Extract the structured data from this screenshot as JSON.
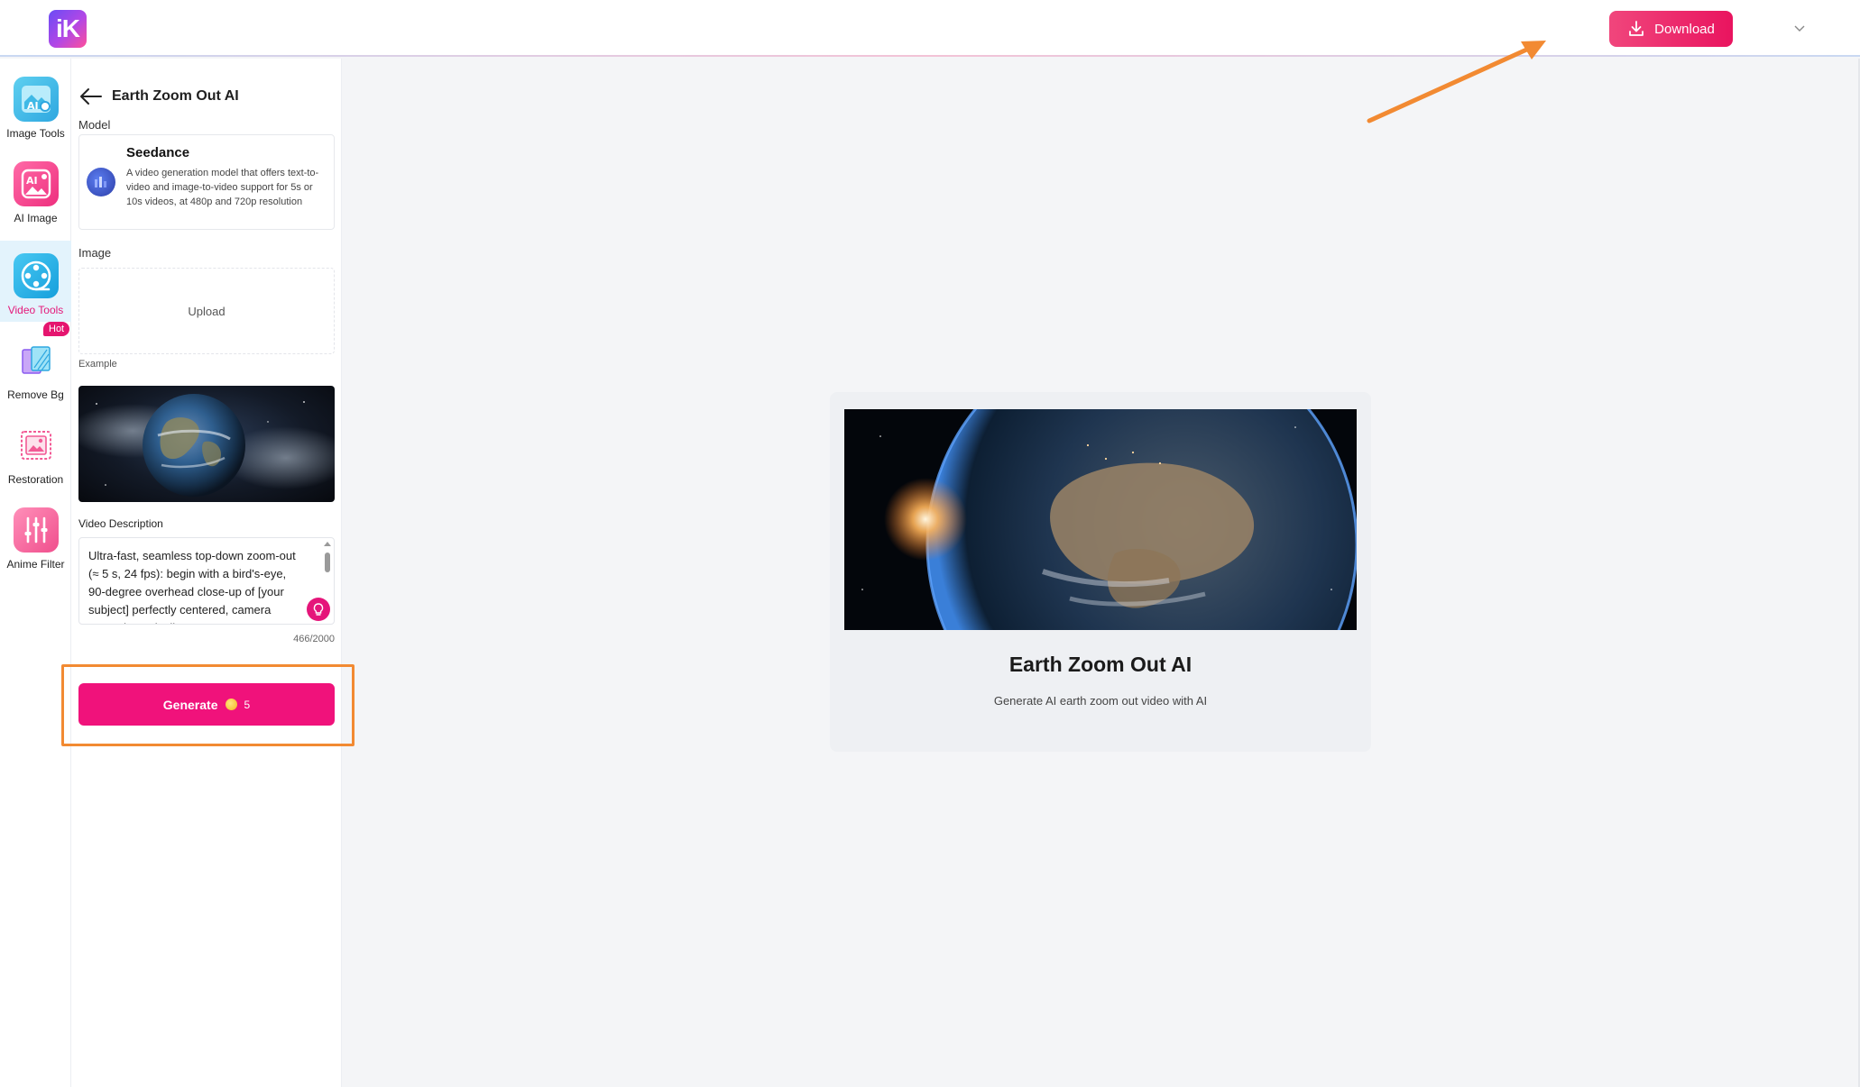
{
  "header": {
    "logo_text": "iK",
    "download_label": "Download"
  },
  "rail": {
    "items": [
      {
        "label": "Image Tools",
        "icon": "image-tools-icon"
      },
      {
        "label": "AI Image",
        "icon": "ai-image-icon"
      },
      {
        "label": "Video Tools",
        "icon": "video-tools-icon",
        "active": true
      },
      {
        "label": "Remove Bg",
        "icon": "remove-bg-icon"
      },
      {
        "label": "Restoration",
        "icon": "restoration-icon"
      },
      {
        "label": "Anime Filter",
        "icon": "anime-filter-icon"
      }
    ],
    "hot_badge": "Hot"
  },
  "panel": {
    "title": "Earth Zoom Out AI",
    "model_label": "Model",
    "model": {
      "name": "Seedance",
      "description": "A video generation model that offers text-to-video and image-to-video support for 5s or 10s videos, at 480p and 720p resolution"
    },
    "image_label": "Image",
    "upload_label": "Upload",
    "example_label": "Example",
    "description_label": "Video Description",
    "description_text": "Ultra-fast, seamless top-down zoom-out (≈ 5 s, 24 fps): begin with a bird's-eye, 90-degree overhead close-up of [your subject] perfectly centered, camera ascends vertically",
    "char_counter": "466/2000",
    "generate_label": "Generate",
    "generate_cost": "5"
  },
  "preview": {
    "title": "Earth Zoom Out AI",
    "subtitle": "Generate AI earth zoom out video with AI"
  },
  "colors": {
    "accent": "#f0127b",
    "annotation": "#f28a32",
    "rail_active_bg": "#e3f3fc"
  }
}
